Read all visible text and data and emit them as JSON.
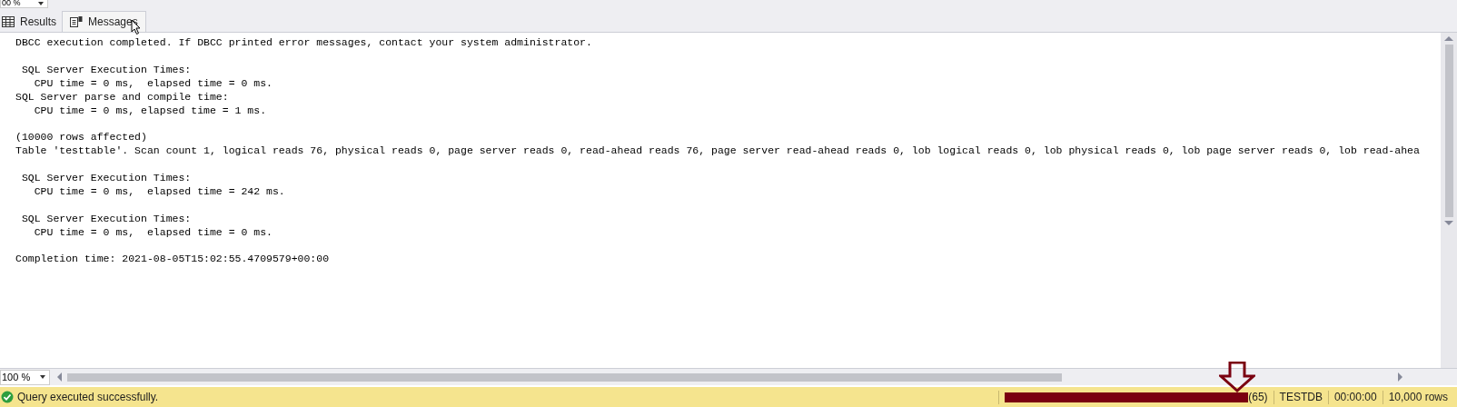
{
  "top_zoom": {
    "value": "00 %"
  },
  "tabs": [
    {
      "label": "Results",
      "kind": "grid",
      "selected": false
    },
    {
      "label": "Messages",
      "kind": "messages",
      "selected": true
    }
  ],
  "message_blocks": [
    [
      "DBCC execution completed. If DBCC printed error messages, contact your system administrator."
    ],
    [
      " SQL Server Execution Times:",
      "   CPU time = 0 ms,  elapsed time = 0 ms.",
      "SQL Server parse and compile time:",
      "   CPU time = 0 ms, elapsed time = 1 ms."
    ],
    [
      "(10000 rows affected)",
      "Table 'testtable'. Scan count 1, logical reads 76, physical reads 0, page server reads 0, read-ahead reads 76, page server read-ahead reads 0, lob logical reads 0, lob physical reads 0, lob page server reads 0, lob read-ahea"
    ],
    [
      " SQL Server Execution Times:",
      "   CPU time = 0 ms,  elapsed time = 242 ms."
    ],
    [
      " SQL Server Execution Times:",
      "   CPU time = 0 ms,  elapsed time = 0 ms."
    ],
    [
      "Completion time: 2021-08-05T15:02:55.4709579+00:00"
    ]
  ],
  "bottom_zoom": {
    "value": "100 %"
  },
  "status_bar": {
    "message": "Query executed successfully.",
    "kind": "success",
    "session": "(65)",
    "database": "TESTDB",
    "elapsed": "00:00:00",
    "rows": "10,000 rows"
  }
}
